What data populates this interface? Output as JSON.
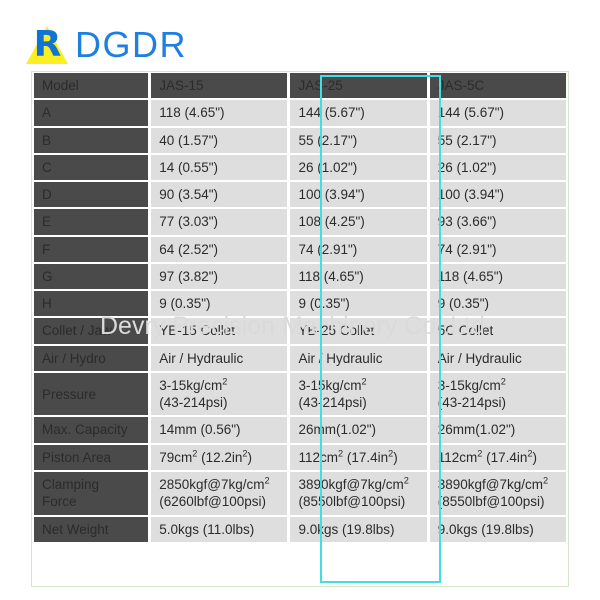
{
  "brand": {
    "logo_icon": "dgdr-triangle-r-logo",
    "logo_letter": "R",
    "logo_text": "DGDR",
    "logo_yellow": "#fdee21",
    "logo_blue": "#1f7fe0"
  },
  "watermark": {
    "text": "Devry Precision Machinery Co.,Ltd"
  },
  "highlight": {
    "column_index": 2,
    "column_label": "JAS-25",
    "color": "#43dde6"
  },
  "spec_table": {
    "row_label_header": "Model",
    "columns": [
      "JAS-15",
      "JAS-25",
      "JAS-5C"
    ],
    "rows": [
      {
        "label": "A",
        "values": [
          "118 (4.65\")",
          "144 (5.67\")",
          "144 (5.67\")"
        ]
      },
      {
        "label": "B",
        "values": [
          "40 (1.57\")",
          "55 (2.17\")",
          "55 (2.17\")"
        ]
      },
      {
        "label": "C",
        "values": [
          "14 (0.55\")",
          "26 (1.02\")",
          "26 (1.02\")"
        ]
      },
      {
        "label": "D",
        "values": [
          "90 (3.54\")",
          "100 (3.94\")",
          "100 (3.94\")"
        ]
      },
      {
        "label": "E",
        "values": [
          "77 (3.03\")",
          "108 (4.25\")",
          "93 (3.66\")"
        ]
      },
      {
        "label": "F",
        "values": [
          "64 (2.52\")",
          "74 (2.91\")",
          "74 (2.91\")"
        ]
      },
      {
        "label": "G",
        "values": [
          "97 (3.82\")",
          "118 (4.65\")",
          "118 (4.65\")"
        ]
      },
      {
        "label": "H",
        "values": [
          "9 (0.35\")",
          "9 (0.35\")",
          "9 (0.35\")"
        ]
      },
      {
        "label": "Collet / Jaw",
        "values": [
          "YB-15 Collet",
          "YB-25 Collet",
          "5C Collet"
        ]
      },
      {
        "label": "Air / Hydro",
        "values": [
          "Air / Hydraulic",
          "Air / Hydraulic",
          "Air / Hydraulic"
        ]
      },
      {
        "label": "Pressure",
        "values_html": [
          "3-15kg/cm<sup>2</sup><br>(43-214psi)",
          "3-15kg/cm<sup>2</sup><br>(43-214psi)",
          "3-15kg/cm<sup>2</sup><br>(43-214psi)"
        ]
      },
      {
        "label": "Max. Capacity",
        "values": [
          "14mm (0.56\")",
          "26mm(1.02\")",
          "26mm(1.02\")"
        ]
      },
      {
        "label": "Piston Area",
        "values_html": [
          "79cm<sup>2</sup> (12.2in<sup>2</sup>)",
          "112cm<sup>2</sup> (17.4in<sup>2</sup>)",
          "112cm<sup>2</sup> (17.4in<sup>2</sup>)"
        ]
      },
      {
        "label": "Clamping Force",
        "label_html": "Clamping<br>Force",
        "values_html": [
          "2850kgf@7kg/cm<sup>2</sup><br>(6260lbf@100psi)",
          "3890kgf@7kg/cm<sup>2</sup><br>(8550lbf@100psi)",
          "3890kgf@7kg/cm<sup>2</sup><br>(8550lbf@100psi)"
        ]
      },
      {
        "label": "Net Weight",
        "values": [
          "5.0kgs (11.0lbs)",
          "9.0kgs (19.8lbs)",
          "9.0kgs (19.8lbs)"
        ]
      }
    ]
  }
}
